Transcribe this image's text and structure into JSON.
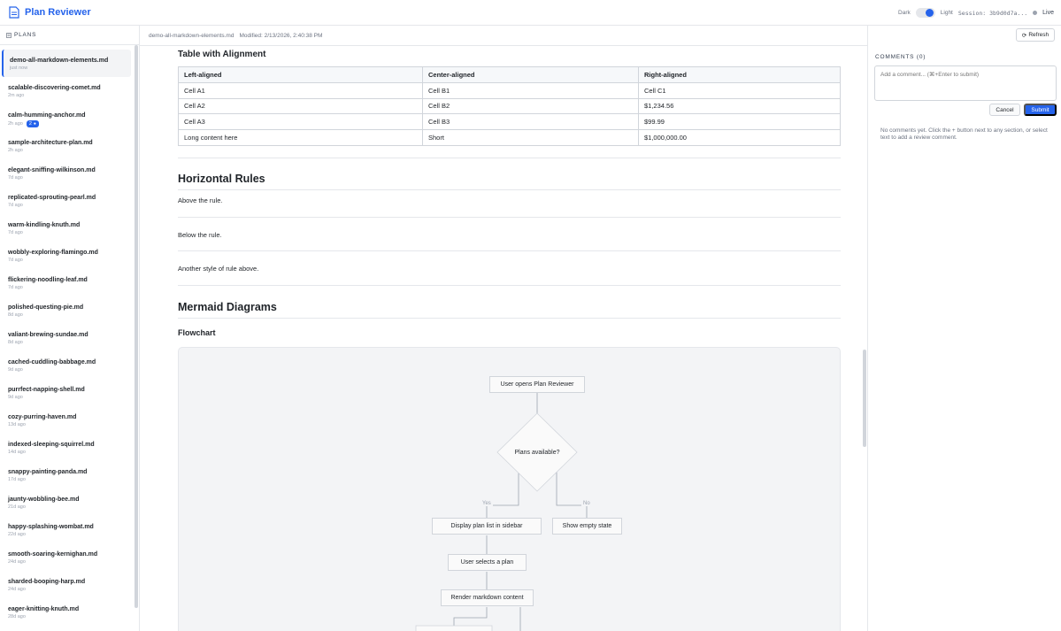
{
  "app": {
    "title": "Plan Reviewer"
  },
  "header": {
    "theme_dark": "Dark",
    "theme_light": "Light",
    "session": "Session: 3b9d0d7a...",
    "live": "Live"
  },
  "sidebar": {
    "heading": "PLANS",
    "plans": [
      {
        "name": "demo-all-markdown-elements.md",
        "time": "just now"
      },
      {
        "name": "scalable-discovering-comet.md",
        "time": "2m ago"
      },
      {
        "name": "calm-humming-anchor.md",
        "time": "2h ago",
        "badge": "2"
      },
      {
        "name": "sample-architecture-plan.md",
        "time": "2h ago"
      },
      {
        "name": "elegant-sniffing-wilkinson.md",
        "time": "7d ago"
      },
      {
        "name": "replicated-sprouting-pearl.md",
        "time": "7d ago"
      },
      {
        "name": "warm-kindling-knuth.md",
        "time": "7d ago"
      },
      {
        "name": "wobbly-exploring-flamingo.md",
        "time": "7d ago"
      },
      {
        "name": "flickering-noodling-leaf.md",
        "time": "7d ago"
      },
      {
        "name": "polished-questing-pie.md",
        "time": "8d ago"
      },
      {
        "name": "valiant-brewing-sundae.md",
        "time": "8d ago"
      },
      {
        "name": "cached-cuddling-babbage.md",
        "time": "9d ago"
      },
      {
        "name": "purrfect-napping-shell.md",
        "time": "9d ago"
      },
      {
        "name": "cozy-purring-haven.md",
        "time": "13d ago"
      },
      {
        "name": "indexed-sleeping-squirrel.md",
        "time": "14d ago"
      },
      {
        "name": "snappy-painting-panda.md",
        "time": "17d ago"
      },
      {
        "name": "jaunty-wobbling-bee.md",
        "time": "21d ago"
      },
      {
        "name": "happy-splashing-wombat.md",
        "time": "22d ago"
      },
      {
        "name": "smooth-soaring-kernighan.md",
        "time": "24d ago"
      },
      {
        "name": "sharded-booping-harp.md",
        "time": "24d ago"
      },
      {
        "name": "eager-knitting-knuth.md",
        "time": "28d ago"
      }
    ]
  },
  "doc": {
    "filename": "demo-all-markdown-elements.md",
    "modified": "Modified: 2/13/2026, 2:40:38 PM",
    "refresh": "Refresh",
    "table_heading": "Table with Alignment",
    "table_headers": [
      "Left-aligned",
      "Center-aligned",
      "Right-aligned"
    ],
    "table_rows": [
      [
        "Cell A1",
        "Cell B1",
        "Cell C1"
      ],
      [
        "Cell A2",
        "Cell B2",
        "$1,234.56"
      ],
      [
        "Cell A3",
        "Cell B3",
        "$99.99"
      ],
      [
        "Long content here",
        "Short",
        "$1,000,000.00"
      ]
    ],
    "hr_heading": "Horizontal Rules",
    "hr_above": "Above the rule.",
    "hr_below": "Below the rule.",
    "hr_another": "Another style of rule above.",
    "mermaid_heading": "Mermaid Diagrams",
    "flowchart_heading": "Flowchart",
    "flow": {
      "start": "User opens Plan Reviewer",
      "decision": "Plans available?",
      "yes": "Yes",
      "no": "No",
      "list": "Display plan list in sidebar",
      "empty": "Show empty state",
      "select": "User selects a plan",
      "render": "Render markdown content"
    }
  },
  "comments": {
    "title": "COMMENTS (0)",
    "placeholder": "Add a comment... (⌘+Enter to submit)",
    "cancel": "Cancel",
    "submit": "Submit",
    "empty": "No comments yet. Click the + button next to any section, or select text to add a review comment."
  }
}
